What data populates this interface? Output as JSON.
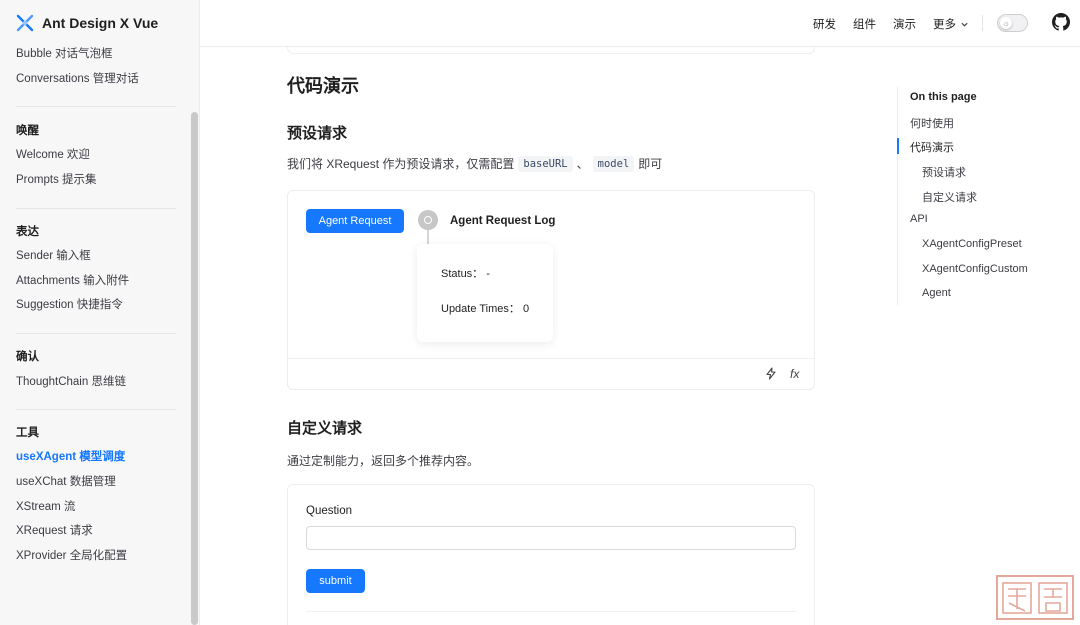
{
  "app": {
    "title": "Ant Design X Vue"
  },
  "sidebar": {
    "top_items": [
      "Bubble 对话气泡框",
      "Conversations 管理对话"
    ],
    "groups": [
      {
        "title": "唤醒",
        "items": [
          "Welcome 欢迎",
          "Prompts 提示集"
        ]
      },
      {
        "title": "表达",
        "items": [
          "Sender 输入框",
          "Attachments 输入附件",
          "Suggestion 快捷指令"
        ]
      },
      {
        "title": "确认",
        "items": [
          "ThoughtChain 思维链"
        ]
      },
      {
        "title": "工具",
        "items": [
          "useXAgent 模型调度",
          "useXChat 数据管理",
          "XStream 流",
          "XRequest 请求",
          "XProvider 全局化配置"
        ]
      }
    ],
    "active_item": "useXAgent 模型调度"
  },
  "topnav": {
    "items": [
      "研发",
      "组件",
      "演示",
      "更多"
    ]
  },
  "content": {
    "heading": "代码演示",
    "preset": {
      "title": "预设请求",
      "desc_before": "我们将 XRequest 作为预设请求，仅需配置",
      "code1": "baseURL",
      "sep": "、",
      "code2": "model",
      "desc_after": "即可",
      "button": "Agent Request",
      "log_title": "Agent Request Log",
      "status_label": "Status：",
      "status_value": "-",
      "update_label": "Update Times：",
      "update_value": "0"
    },
    "custom": {
      "title": "自定义请求",
      "desc": "通过定制能力，返回多个推荐内容。",
      "question_label": "Question",
      "question_value": "",
      "submit": "submit"
    }
  },
  "toc": {
    "title": "On this page",
    "items": [
      "何时使用",
      "代码演示",
      "预设请求",
      "自定义请求",
      "API",
      "XAgentConfigPreset",
      "XAgentConfigCustom",
      "Agent"
    ],
    "active": "代码演示"
  },
  "colors": {
    "accent": "#1677ff",
    "seal": "#e4a89a"
  },
  "icons": {
    "logo": "x-logo-icon",
    "dropdown": "chevron-down-icon",
    "theme": "theme-toggle",
    "github": "github-icon",
    "thunder": "thunderbolt-icon",
    "fx": "function-icon"
  }
}
